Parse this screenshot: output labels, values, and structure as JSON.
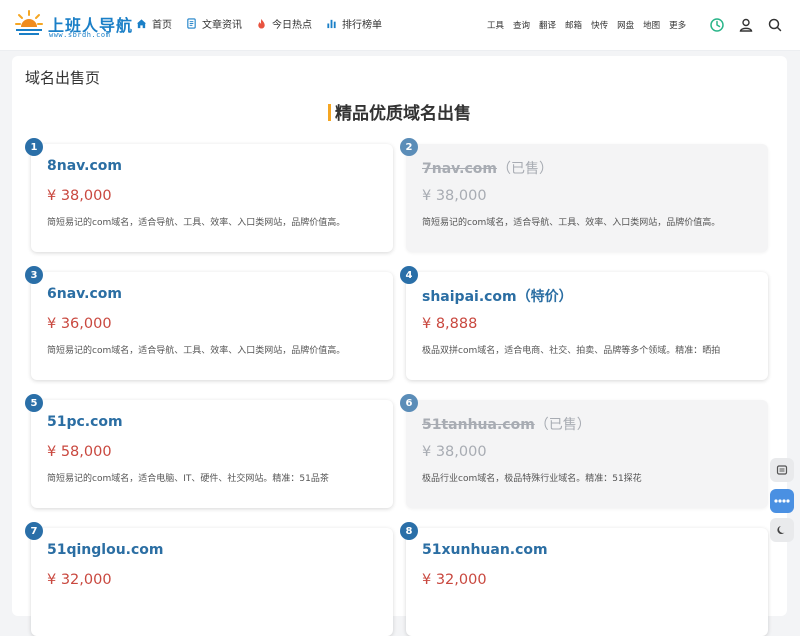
{
  "header": {
    "logo_title": "上班人导航",
    "logo_url": "www.sbrdh.com",
    "nav": [
      {
        "label": "首页"
      },
      {
        "label": "文章资讯"
      },
      {
        "label": "今日热点"
      },
      {
        "label": "排行榜单"
      }
    ],
    "nav_right": [
      "工具",
      "查询",
      "翻译",
      "邮箱",
      "快传",
      "网盘",
      "地图",
      "更多"
    ]
  },
  "page": {
    "title": "域名出售页",
    "section_title": "精品优质域名出售"
  },
  "cards": [
    {
      "num": "1",
      "domain": "8nav.com",
      "suffix": "",
      "price": "¥ 38,000",
      "desc": "简短易记的com域名，适合导航、工具、效率、入口类网站，品牌价值高。",
      "sold": false
    },
    {
      "num": "2",
      "domain": "7nav.com",
      "suffix": "（已售）",
      "price": "¥ 38,000",
      "desc": "简短易记的com域名，适合导航、工具、效率、入口类网站，品牌价值高。",
      "sold": true
    },
    {
      "num": "3",
      "domain": "6nav.com",
      "suffix": "",
      "price": "¥ 36,000",
      "desc": "简短易记的com域名，适合导航、工具、效率、入口类网站，品牌价值高。",
      "sold": false
    },
    {
      "num": "4",
      "domain": "shaipai.com（特价）",
      "suffix": "",
      "price": "¥ 8,888",
      "desc": "极品双拼com域名，适合电商、社交、拍卖、品牌等多个领域。精准：晒拍",
      "sold": false
    },
    {
      "num": "5",
      "domain": "51pc.com",
      "suffix": "",
      "price": "¥ 58,000",
      "desc": "简短易记的com域名，适合电脑、IT、硬件、社交网站。精准：51品茶",
      "sold": false
    },
    {
      "num": "6",
      "domain": "51tanhua.com",
      "suffix": "（已售）",
      "price": "¥ 38,000",
      "desc": "极品行业com域名，极品特殊行业域名。精准：51探花",
      "sold": true
    },
    {
      "num": "7",
      "domain": "51qinglou.com",
      "suffix": "",
      "price": "¥ 32,000",
      "desc": "",
      "sold": false
    },
    {
      "num": "8",
      "domain": "51xunhuan.com",
      "suffix": "",
      "price": "¥ 32,000",
      "desc": "",
      "sold": false
    }
  ],
  "colors": {
    "accent_blue": "#2b6ea3",
    "price_red": "#c9483f",
    "title_bar": "#f5a623",
    "logo_blue": "#1a7fc7"
  },
  "icons": {
    "nav": [
      "home-icon",
      "document-icon",
      "fire-icon",
      "ranking-icon"
    ],
    "header_right": [
      "clock-icon",
      "user-icon",
      "search-icon"
    ],
    "floating": [
      "message-icon",
      "more-icon",
      "dark-mode-icon"
    ]
  }
}
